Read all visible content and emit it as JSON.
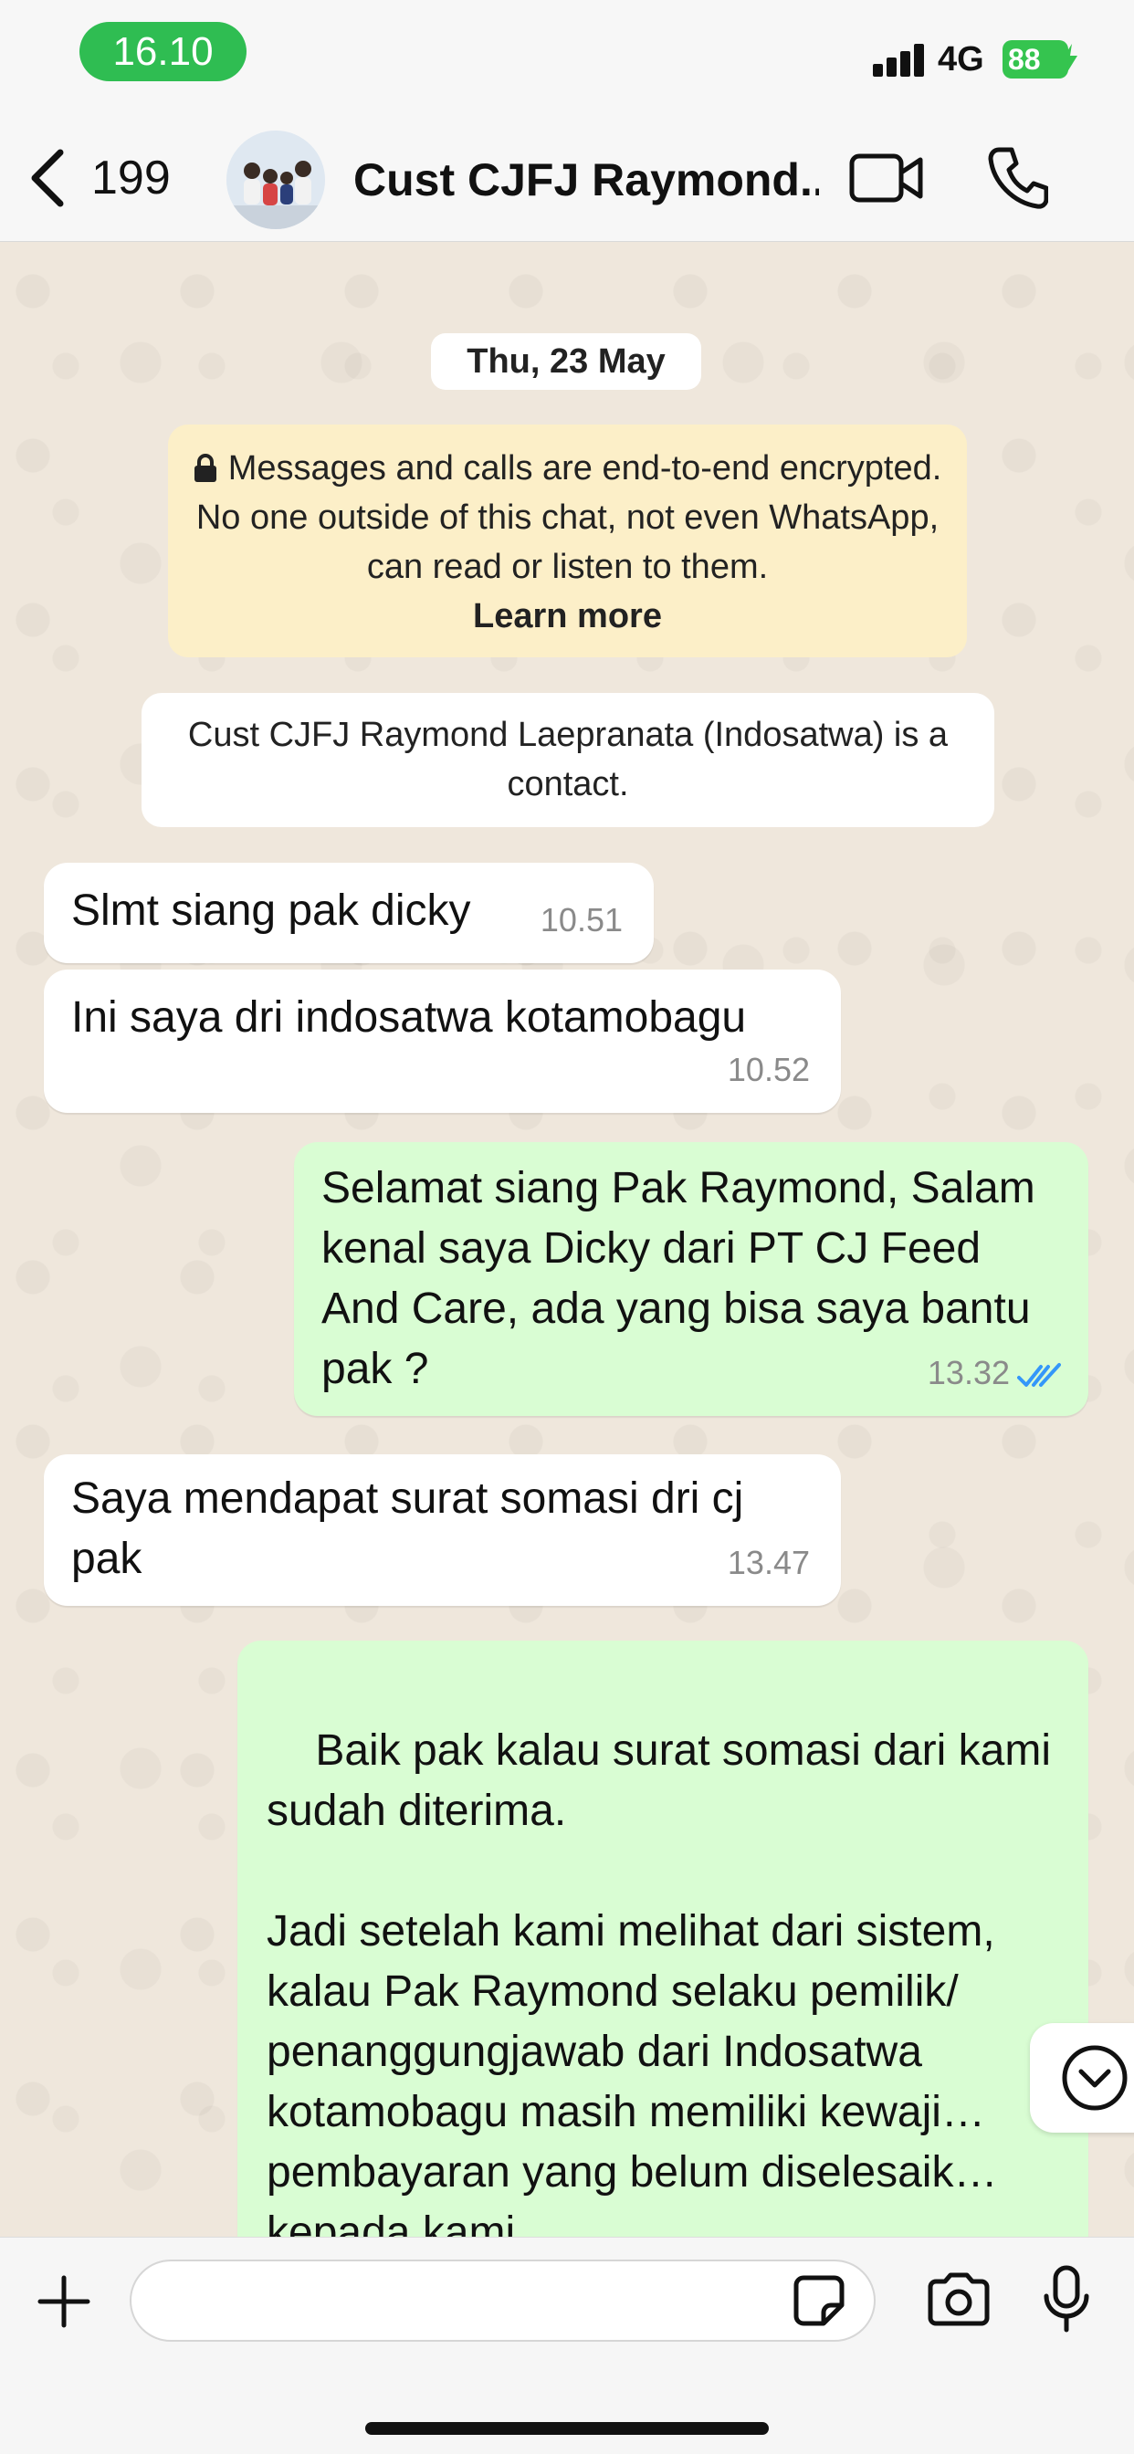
{
  "status_bar": {
    "time": "16.10",
    "network": "4G",
    "battery": "88"
  },
  "header": {
    "back_count": "199",
    "title": "Cust CJFJ Raymond..."
  },
  "chat": {
    "date_chip": "Thu, 23 May",
    "encryption_notice": {
      "text": "Messages and calls are end-to-end encrypted. No one outside of this chat, not even WhatsApp, can read or listen to them.",
      "link": "Learn more"
    },
    "contact_notice": "Cust CJFJ Raymond Laepranata (Indosatwa) is a contact.",
    "messages": [
      {
        "direction": "in",
        "text": "Slmt siang pak dicky",
        "time": "10.51"
      },
      {
        "direction": "in",
        "text": "Ini saya dri indosatwa kotamobagu",
        "time": "10.52"
      },
      {
        "direction": "out",
        "text": "Selamat siang Pak Raymond, Salam kenal saya Dicky dari PT CJ Feed And Care, ada yang bisa saya bantu pak ?",
        "time": "13.32",
        "status": "read"
      },
      {
        "direction": "in",
        "text": "Saya mendapat surat somasi dri cj pak",
        "time": "13.47"
      },
      {
        "direction": "out",
        "text": "Baik pak kalau surat somasi dari kami sudah diterima.\n\nJadi setelah kami melihat dari sistem, kalau Pak Raymond selaku pemilik/ penanggungjawab dari Indosatwa kotamobagu masih memiliki kewaji… pembayaran yang belum diselesaik… kepada kami."
      }
    ]
  },
  "composer": {
    "placeholder": ""
  },
  "icons": {
    "back": "chevron-left-icon",
    "video": "video-camera-icon",
    "call": "phone-icon",
    "lock": "lock-icon",
    "read_receipt": "double-check-icon",
    "scroll": "chevron-down-circle-icon",
    "plus": "plus-icon",
    "sticker": "sticker-icon",
    "camera": "camera-icon",
    "mic": "microphone-icon"
  },
  "colors": {
    "outgoing_bubble": "#d9fdd3",
    "incoming_bubble": "#ffffff",
    "read_tick": "#3497f9",
    "time_pill": "#2fbd52",
    "battery": "#35c44f",
    "encryption_card": "#fcefc8"
  }
}
